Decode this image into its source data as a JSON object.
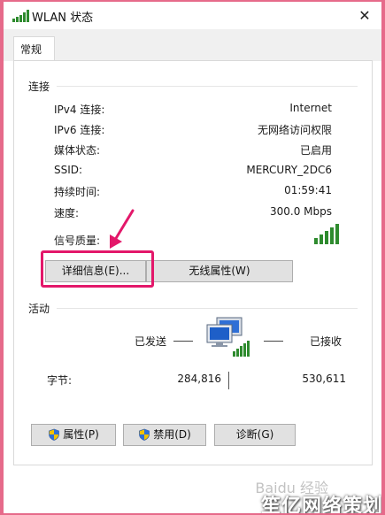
{
  "window": {
    "title": "WLAN 状态",
    "close_glyph": "✕"
  },
  "tabs": [
    {
      "label": "常规"
    }
  ],
  "connection": {
    "section_title": "连接",
    "rows": [
      {
        "label": "IPv4 连接:",
        "value": "Internet"
      },
      {
        "label": "IPv6 连接:",
        "value": "无网络访问权限"
      },
      {
        "label": "媒体状态:",
        "value": "已启用"
      },
      {
        "label": "SSID:",
        "value": "MERCURY_2DC6"
      },
      {
        "label": "持续时间:",
        "value": "01:59:41"
      },
      {
        "label": "速度:",
        "value": "300.0 Mbps"
      }
    ],
    "signal_label": "信号质量:",
    "signal_bars": 5,
    "details_button": "详细信息(E)...",
    "wireless_props_button": "无线属性(W)"
  },
  "activity": {
    "section_title": "活动",
    "sent_label": "已发送",
    "received_label": "已接收",
    "bytes_label": "字节:",
    "bytes_sent": "284,816",
    "bytes_received": "530,611"
  },
  "buttons": {
    "properties": "属性(P)",
    "disable": "禁用(D)",
    "diagnose": "诊断(G)"
  },
  "watermark": {
    "main": "笙亿网络策划",
    "faint": "Baidu 经验"
  },
  "colors": {
    "background": "#e66a8a",
    "highlight": "#e3186a",
    "arrow": "#e3186a",
    "signal": "#2e8b2e"
  }
}
